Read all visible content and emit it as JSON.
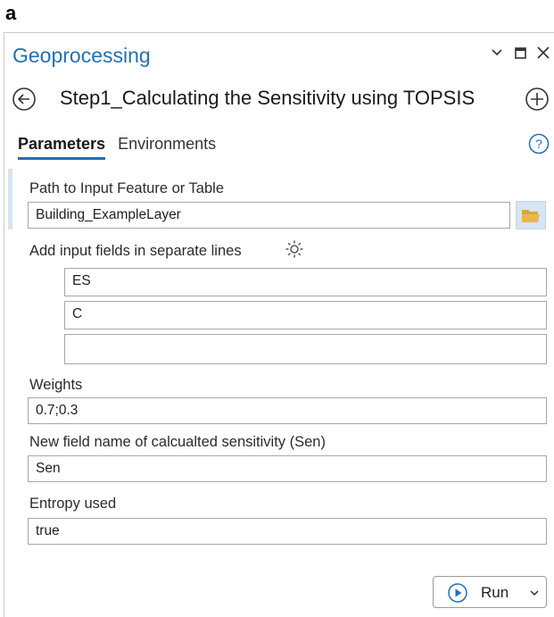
{
  "figure_label": "a",
  "window": {
    "title": "Geoprocessing",
    "controls": {
      "dropdown_icon": "chevron-down-icon",
      "maximize_icon": "square-icon",
      "close_icon": "close-icon"
    }
  },
  "tool": {
    "back_icon": "circle-arrow-left-icon",
    "title": "Step1_Calculating the Sensitivity using TOPSIS",
    "add_icon": "circle-plus-icon"
  },
  "tabs": [
    {
      "label": "Parameters",
      "active": true
    },
    {
      "label": "Environments",
      "active": false
    }
  ],
  "help_icon": "question-circle-icon",
  "parameters": {
    "input_path": {
      "label": "Path to Input Feature or Table",
      "value": "Building_ExampleLayer",
      "browse_icon": "folder-open-icon"
    },
    "input_fields": {
      "label": "Add input fields in separate lines",
      "options_icon": "gear-icon",
      "values": [
        "ES",
        "C",
        ""
      ]
    },
    "weights": {
      "label": "Weights",
      "value": "0.7;0.3"
    },
    "new_field": {
      "label": "New field name of calcualted sensitivity (Sen)",
      "value": "Sen"
    },
    "entropy": {
      "label": "Entropy used",
      "value": "true"
    }
  },
  "run_button": {
    "label": "Run",
    "icon": "play-circle-icon",
    "dropdown_icon": "chevron-down-icon"
  },
  "colors": {
    "accent_blue": "#2170b8",
    "border_gray": "#a8a8a8",
    "browse_bg": "#d5e5f3",
    "folder_yellow": "#e8b94a"
  }
}
